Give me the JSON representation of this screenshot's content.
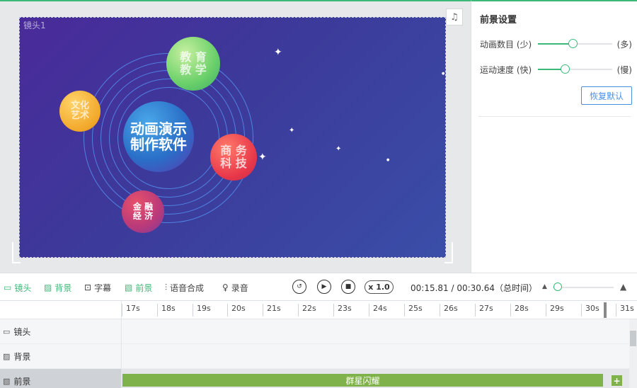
{
  "canvas": {
    "lens_label": "镜头1",
    "music_icon": "♫",
    "center_planet": {
      "line1": "动画演示",
      "line2": "制作软件"
    },
    "planets": [
      {
        "line1": "教 育",
        "line2": "教 学"
      },
      {
        "line1": "文化",
        "line2": "艺术"
      },
      {
        "line1": "商 务",
        "line2": "科 技"
      },
      {
        "line1": "金 融",
        "line2": "经 济"
      }
    ]
  },
  "panel": {
    "title": "前景设置",
    "sliders": [
      {
        "label": "动画数目 (少)",
        "end": "(多)",
        "value": 0.47
      },
      {
        "label": "运动速度 (快)",
        "end": "(慢)",
        "value": 0.36
      }
    ],
    "reset_label": "恢复默认"
  },
  "toolbar": {
    "lens": "镜头",
    "background": "背景",
    "subtitle": "字幕",
    "foreground": "前景",
    "tts": "语音合成",
    "record": "录音",
    "speed": "x 1.0",
    "time": "00:15.81 / 00:30.64（总时间）"
  },
  "ruler": {
    "ticks": [
      "17s",
      "18s",
      "19s",
      "20s",
      "21s",
      "22s",
      "23s",
      "24s",
      "25s",
      "26s",
      "27s",
      "28s",
      "29s",
      "30s",
      "31s"
    ]
  },
  "tracks": [
    {
      "label": "镜头"
    },
    {
      "label": "背景"
    },
    {
      "label": "前景"
    }
  ],
  "clip": {
    "label": "群星闪耀",
    "add": "+"
  },
  "colors": {
    "accent": "#3cb878",
    "clip": "#7fb24a",
    "link": "#4a90e2"
  }
}
